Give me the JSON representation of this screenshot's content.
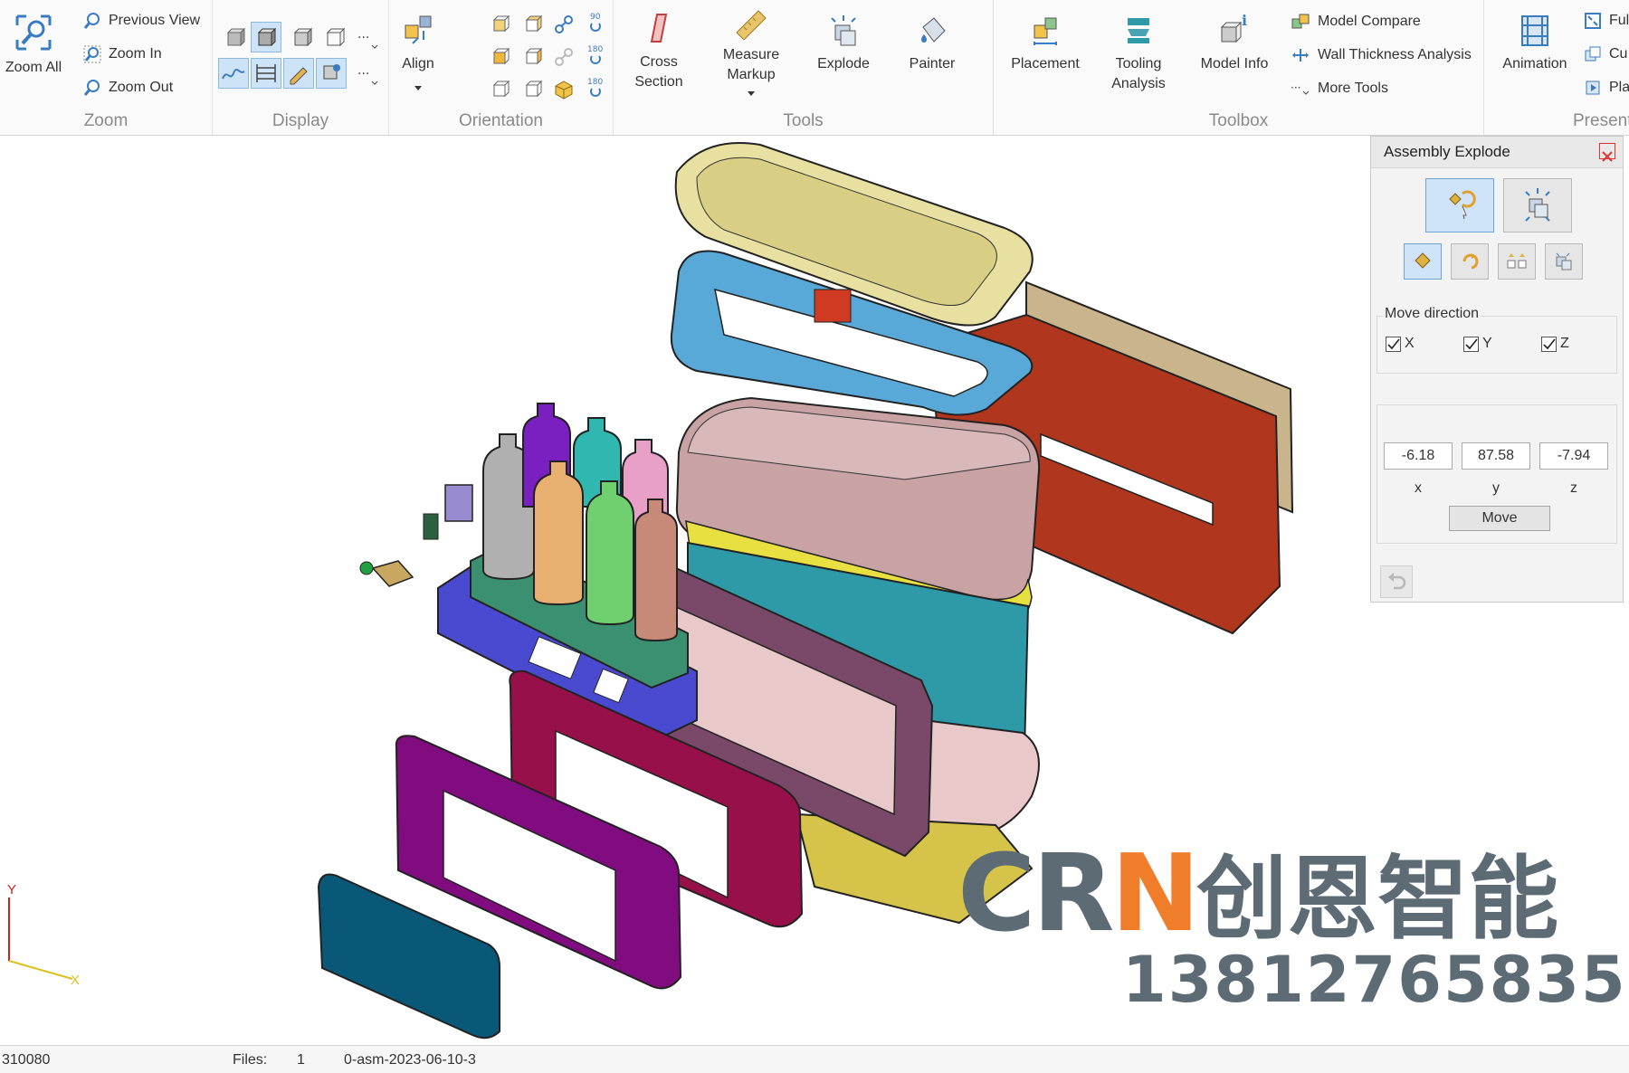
{
  "ribbon": {
    "zoom": {
      "label": "Zoom",
      "zoom_all": "Zoom All",
      "previous_view": "Previous View",
      "zoom_in": "Zoom In",
      "zoom_out": "Zoom Out"
    },
    "display": {
      "label": "Display"
    },
    "orientation": {
      "label": "Orientation",
      "align": "Align",
      "deg90": "90",
      "deg180a": "180",
      "deg180b": "180"
    },
    "tools": {
      "label": "Tools",
      "cross_section": [
        "Cross",
        "Section"
      ],
      "measure_markup": [
        "Measure",
        "Markup"
      ],
      "explode": "Explode",
      "painter": "Painter"
    },
    "toolbox": {
      "label": "Toolbox",
      "placement": "Placement",
      "tooling_analysis": [
        "Tooling",
        "Analysis"
      ],
      "model_info": "Model Info",
      "model_compare": "Model Compare",
      "wall_thickness": "Wall Thickness Analysis",
      "more_tools": "More Tools"
    },
    "presentation": {
      "label": "Presenta",
      "animation": "Animation",
      "full": "Ful",
      "cu": "Cu",
      "pla": "Pla"
    }
  },
  "panel": {
    "title": "Assembly Explode",
    "move_direction_label": "Move direction",
    "checkboxes": [
      {
        "label": "X",
        "checked": true
      },
      {
        "label": "Y",
        "checked": true
      },
      {
        "label": "Z",
        "checked": true
      }
    ],
    "values": {
      "x": "-6.18",
      "y": "87.58",
      "z": "-7.94"
    },
    "axis_labels": {
      "x": "x",
      "y": "y",
      "z": "z"
    },
    "move_button": "Move"
  },
  "viewport": {
    "triad": {
      "y": "Y",
      "x": "X"
    },
    "watermark": {
      "brand_prefix": "C",
      "brand_accent_r": "R",
      "brand_n": "N",
      "brand_cn": "创恩智能",
      "phone": "13812765835"
    }
  },
  "status": {
    "left_number": "310080",
    "files_label": "Files:",
    "files_count": "1",
    "file_name": "0-asm-2023-06-10-3"
  },
  "colors": {
    "accent_blue": "#3a7cc2",
    "selected_bg": "#cde3f7",
    "watermark_gray": "#5d6b75",
    "watermark_orange": "#f07d2a"
  }
}
